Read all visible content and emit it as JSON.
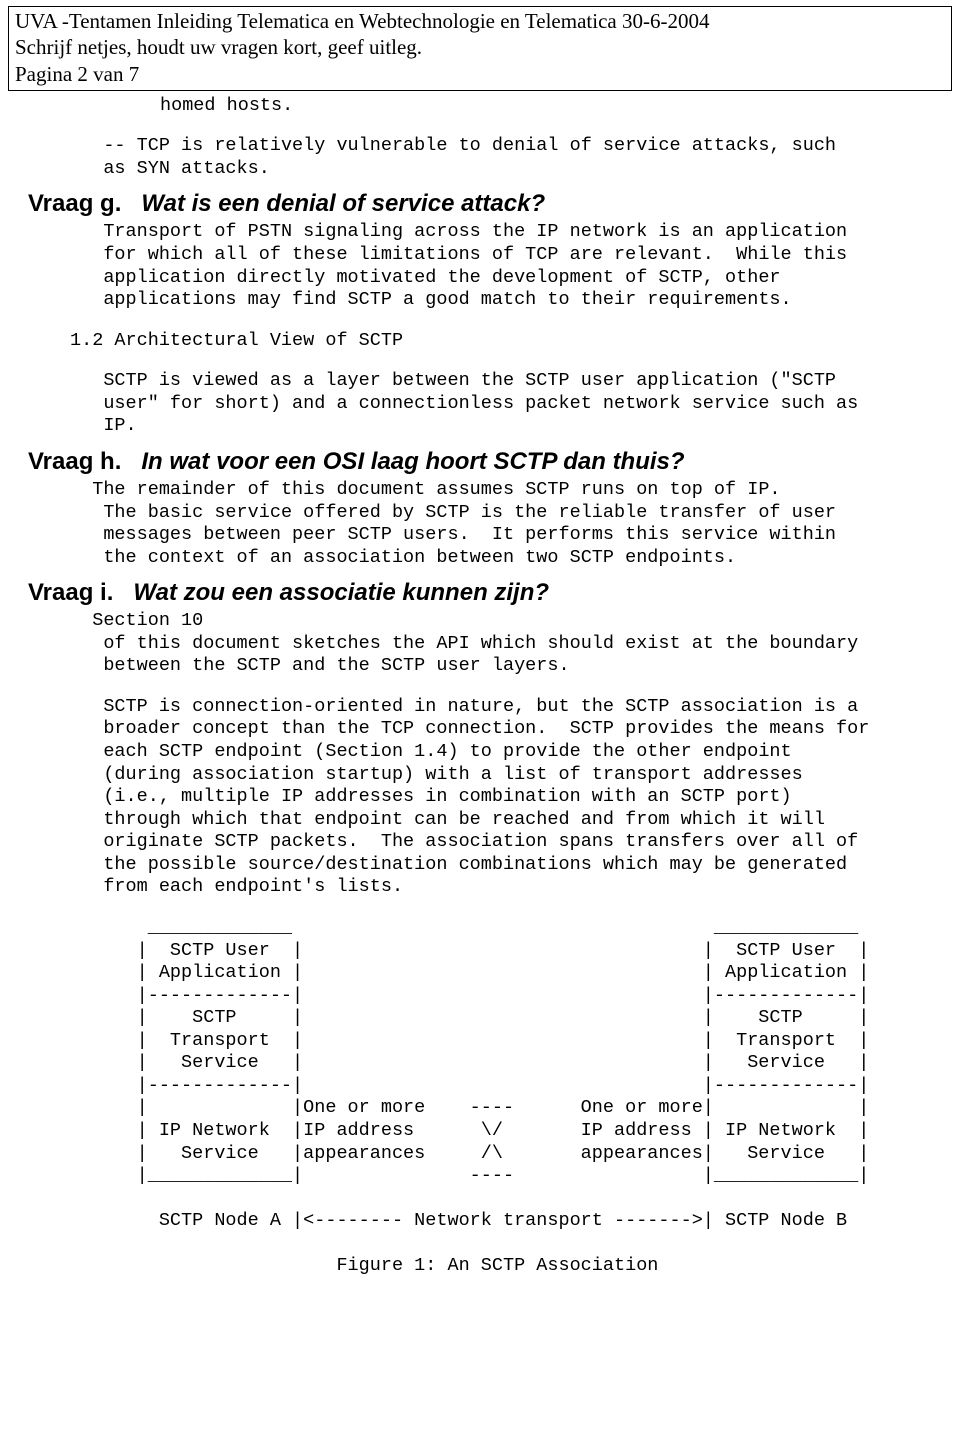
{
  "header": {
    "line1": "UVA -Tentamen Inleiding Telematica en Webtechnologie en Telematica 30-6-2004",
    "line2": "Schrijf netjes, houdt uw vragen kort, geef uitleg.",
    "line3": "Pagina 2 van 7"
  },
  "body": {
    "homed": "homed hosts.",
    "tcp_vuln": "   -- TCP is relatively vulnerable to denial of service attacks, such\n   as SYN attacks.",
    "q_g_label": "Vraag  g.",
    "q_g_text": "Wat is een denial of service attack?",
    "pstn": "   Transport of PSTN signaling across the IP network is an application\n   for which all of these limitations of TCP are relevant.  While this\n   application directly motivated the development of SCTP, other\n   applications may find SCTP a good match to their requirements.",
    "arch_hdr": "1.2 Architectural View of SCTP",
    "arch_para": "   SCTP is viewed as a layer between the SCTP user application (\"SCTP\n   user\" for short) and a connectionless packet network service such as\n   IP.",
    "q_h_label": "Vraag  h.",
    "q_h_text": "In wat voor een OSI laag hoort SCTP dan thuis?",
    "remainder": "  The remainder of this document assumes SCTP runs on top of IP.\n   The basic service offered by SCTP is the reliable transfer of user\n   messages between peer SCTP users.  It performs this service within\n   the context of an association between two SCTP endpoints.",
    "q_i_label": "Vraag  i.",
    "q_i_text": "Wat zou een associatie kunnen zijn?",
    "section10": "  Section 10\n   of this document sketches the API which should exist at the boundary\n   between the SCTP and the SCTP user layers.",
    "conn_para": "   SCTP is connection-oriented in nature, but the SCTP association is a\n   broader concept than the TCP connection.  SCTP provides the means for\n   each SCTP endpoint (Section 1.4) to provide the other endpoint\n   (during association startup) with a list of transport addresses\n   (i.e., multiple IP addresses in combination with an SCTP port)\n   through which that endpoint can be reached and from which it will\n   originate SCTP packets.  The association spans transfers over all of\n   the possible source/destination combinations which may be generated\n   from each endpoint's lists.",
    "diagram": "       _____________                                      _____________\n      |  SCTP User  |                                    |  SCTP User  |\n      | Application |                                    | Application |\n      |-------------|                                    |-------------|\n      |    SCTP     |                                    |    SCTP     |\n      |  Transport  |                                    |  Transport  |\n      |   Service   |                                    |   Service   |\n      |-------------|                                    |-------------|\n      |             |One or more    ----      One or more|             |\n      | IP Network  |IP address      \\/       IP address | IP Network  |\n      |   Service   |appearances     /\\       appearances|   Service   |\n      |_____________|               ----                 |_____________|\n\n        SCTP Node A |<-------- Network transport ------->| SCTP Node B\n\n                        Figure 1: An SCTP Association"
  }
}
